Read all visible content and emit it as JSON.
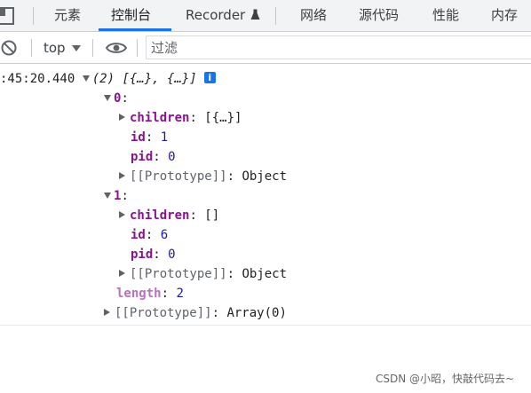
{
  "tabs": [
    {
      "label": "元素"
    },
    {
      "label": "控制台",
      "active": true
    },
    {
      "label": "Recorder",
      "icon": "flask-icon"
    },
    {
      "label": "网络"
    },
    {
      "label": "源代码"
    },
    {
      "label": "性能"
    },
    {
      "label": "内存"
    }
  ],
  "toolbar": {
    "context": "top",
    "filter_placeholder": "过滤"
  },
  "console": {
    "timestamp": ":45:20.440",
    "summary": "(2) [{…}, {…}]",
    "items": [
      {
        "index": "0",
        "children_key": "children",
        "children_preview": "[{…}]",
        "id_key": "id",
        "id": "1",
        "pid_key": "pid",
        "pid": "0",
        "proto_key": "[[Prototype]]",
        "proto_value": "Object"
      },
      {
        "index": "1",
        "children_key": "children",
        "children_preview": "[]",
        "id_key": "id",
        "id": "6",
        "pid_key": "pid",
        "pid": "0",
        "proto_key": "[[Prototype]]",
        "proto_value": "Object"
      }
    ],
    "length_key": "length",
    "length": "2",
    "array_proto_key": "[[Prototype]]",
    "array_proto_value": "Array(0)"
  },
  "colors": {
    "accent": "#1a73e8",
    "key": "#881391",
    "number": "#1a1aa6"
  },
  "watermark": "CSDN @小昭，快敲代码去~"
}
